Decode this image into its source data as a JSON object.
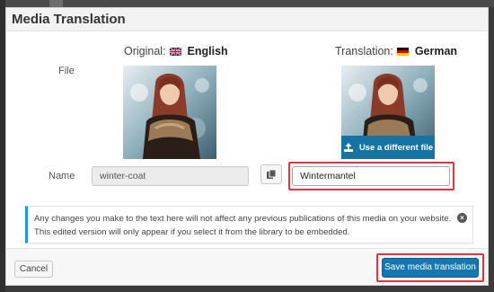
{
  "dialog": {
    "title": "Media Translation"
  },
  "columns": {
    "original": {
      "prefix": "Original:",
      "language": "English",
      "flag_icon": "uk-flag-icon"
    },
    "translation": {
      "prefix": "Translation:",
      "language": "German",
      "flag_icon": "germany-flag-icon"
    }
  },
  "labels": {
    "file": "File",
    "name": "Name"
  },
  "file": {
    "use_different_label": "Use a different file",
    "upload_icon": "upload-icon"
  },
  "fields": {
    "original_name": "winter-coat",
    "translated_name": "Wintermantel",
    "copy_icon": "copy-icon"
  },
  "notice": {
    "line1": "Any changes you make to the text here will not affect any previous publications of this media on your website.",
    "line2": "This edited version will only appear if you select it from the library to be embedded.",
    "dismiss_icon": "dismiss-icon"
  },
  "footer": {
    "cancel_label": "Cancel",
    "save_label": "Save media translation"
  },
  "colors": {
    "primary_button": "#1677b0",
    "notice_accent": "#1e9bd7",
    "highlight": "#e1343d"
  }
}
